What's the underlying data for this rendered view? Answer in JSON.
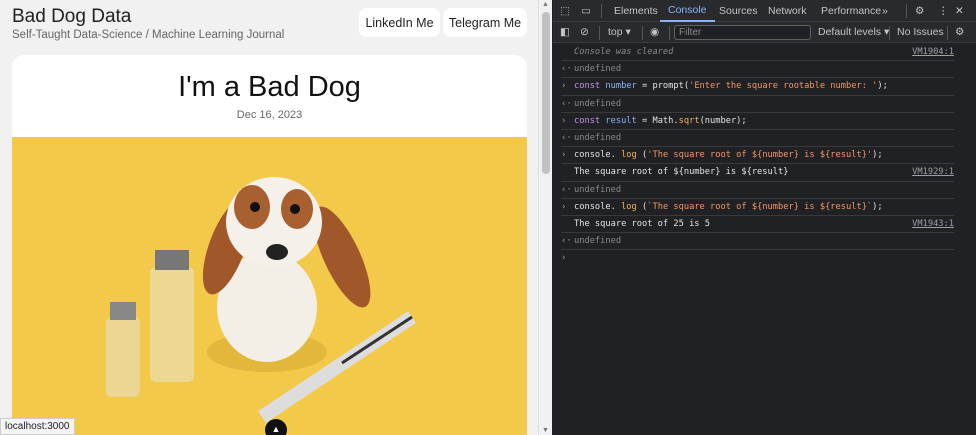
{
  "page": {
    "site_title": "Bad Dog Data",
    "site_subtitle": "Self-Taught Data-Science / Machine Learning Journal",
    "buttons": [
      "LinkedIn Me",
      "Telegram Me"
    ],
    "post_title": "I'm a Bad Dog",
    "post_date": "Dec 16, 2023",
    "status_url": "localhost:3000"
  },
  "devtools": {
    "tabs": [
      "Elements",
      "Console",
      "Sources",
      "Network",
      "Performance"
    ],
    "active_tab": "Console",
    "context": "top",
    "filter_placeholder": "Filter",
    "levels": "Default levels",
    "issues": "No Issues",
    "rows": [
      {
        "type": "info",
        "text": "Console was cleared",
        "source": "VM1904:1"
      },
      {
        "type": "result",
        "text": "undefined"
      },
      {
        "type": "input",
        "parts": [
          "const",
          "number",
          "= prompt(",
          "'Enter the square rootable number: '",
          ");"
        ]
      },
      {
        "type": "result",
        "text": "undefined"
      },
      {
        "type": "input",
        "parts": [
          "const",
          "result",
          "= Math.",
          "sqrt",
          "(number);"
        ]
      },
      {
        "type": "result",
        "text": "undefined"
      },
      {
        "type": "input",
        "parts": [
          "console.",
          "log",
          "(",
          "'The square root of ${number} is ${result}'",
          ");"
        ]
      },
      {
        "type": "log",
        "text": "The square root of ${number} is ${result}",
        "source": "VM1929:1"
      },
      {
        "type": "result",
        "text": "undefined"
      },
      {
        "type": "input",
        "parts": [
          "console.",
          "log",
          "(",
          "`The square root of ${number} is ${result}`",
          ");"
        ]
      },
      {
        "type": "log",
        "text": "The square root of 25 is 5",
        "source": "VM1943:1"
      },
      {
        "type": "result",
        "text": "undefined"
      }
    ]
  }
}
